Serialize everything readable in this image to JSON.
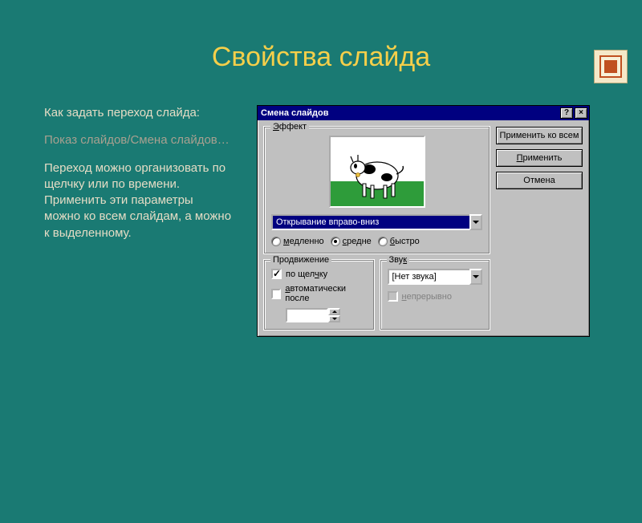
{
  "slide": {
    "title": "Свойства слайда",
    "p1": "Как задать переход слайда:",
    "p2": "Показ слайдов/Смена слайдов…",
    "p3": "Переход можно организовать по щелчку или по времени. Применить эти параметры можно ко всем слайдам, а можно к выделенному."
  },
  "dialog": {
    "title": "Смена слайдов",
    "help": "?",
    "close": "×",
    "effect": {
      "group_label": "Эффект",
      "selected": "Открывание вправо-вниз",
      "speed": {
        "slow": "медленно",
        "medium": "средне",
        "fast": "быстро",
        "selected": "medium"
      }
    },
    "advance": {
      "group_label": "Продвижение",
      "on_click": "по щелчку",
      "auto_after": "автоматически после",
      "time_value": ""
    },
    "sound": {
      "group_label": "Звук",
      "selected": "[Нет звука]",
      "loop": "непрерывно"
    },
    "buttons": {
      "apply_all": "Применить ко всем",
      "apply": "Применить",
      "cancel": "Отмена"
    }
  }
}
